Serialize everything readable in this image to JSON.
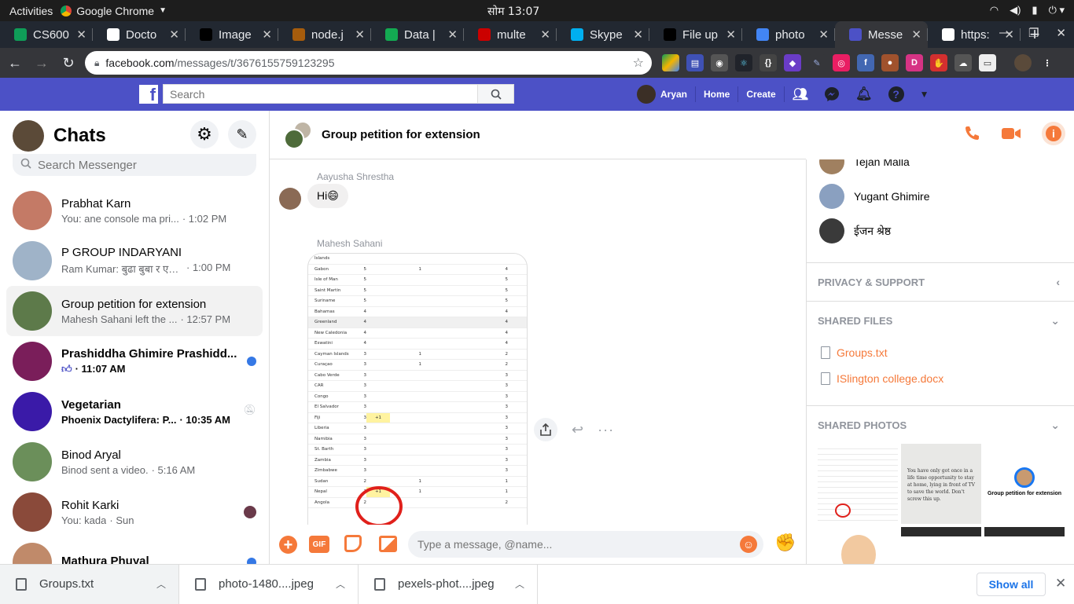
{
  "desktop": {
    "activities": "Activities",
    "app_name": "Google Chrome",
    "clock": "सोम 13:07"
  },
  "tabs": [
    {
      "title": "CS600",
      "favicon_color": "#0f9d58"
    },
    {
      "title": "Docto",
      "favicon_color": "#ffffff"
    },
    {
      "title": "Image",
      "favicon_color": "#000000"
    },
    {
      "title": "node.j",
      "favicon_color": "#a65c0c"
    },
    {
      "title": "Data |",
      "favicon_color": "#13aa52"
    },
    {
      "title": "multe",
      "favicon_color": "#cb0000"
    },
    {
      "title": "Skype",
      "favicon_color": "#00aff0"
    },
    {
      "title": "File up",
      "favicon_color": "#000000"
    },
    {
      "title": "photo",
      "favicon_color": "#4285f4"
    },
    {
      "title": "Messe",
      "favicon_color": "#4c51c6"
    },
    {
      "title": "https:",
      "favicon_color": "#ffffff"
    }
  ],
  "url": {
    "host": "facebook.com",
    "path": "/messages/t/3676155759123295"
  },
  "fb": {
    "search_placeholder": "Search",
    "user_name": "Aryan",
    "nav_home": "Home",
    "nav_create": "Create",
    "brand_color": "#4c51c6"
  },
  "sidebar": {
    "title": "Chats",
    "search_placeholder": "Search Messenger",
    "chats": [
      {
        "name": "Prabhat Karn",
        "preview": "You: ane console ma pri...",
        "time": "1:02 PM",
        "unread": false
      },
      {
        "name": "P GROUP INDARYANI",
        "preview": "Ram Kumar: बुढा बुबा र एक ...",
        "time": "1:00 PM",
        "unread": false
      },
      {
        "name": "Group petition for extension",
        "preview": "Mahesh Sahani left the ...",
        "time": "12:57 PM",
        "unread": false
      },
      {
        "name": "Prashiddha Ghimire Prashidd...",
        "preview": "",
        "time": "11:07 AM",
        "unread": true
      },
      {
        "name": "Vegetarian",
        "preview": "Phoenix Dactylifera: P...",
        "time": "10:35 AM",
        "unread": true
      },
      {
        "name": "Binod Aryal",
        "preview": "Binod sent a video.",
        "time": "5:16 AM",
        "unread": false
      },
      {
        "name": "Rohit Karki",
        "preview": "You: kada",
        "time": "Sun",
        "unread": false
      },
      {
        "name": "Mathura Phuyal",
        "preview": "",
        "time": "",
        "unread": true
      }
    ]
  },
  "conversation": {
    "title": "Group petition for extension",
    "messages": [
      {
        "sender": "Aayusha Shrestha",
        "text": "Hi😄"
      },
      {
        "sender": "Mahesh Sahani",
        "text": ""
      }
    ],
    "composer_placeholder": "Type a message, @name...",
    "accent": "#f5793a"
  },
  "sheet_rows": [
    [
      "Islands",
      "",
      "",
      "",
      ""
    ],
    [
      "Gabon",
      "5",
      "",
      "1",
      "4"
    ],
    [
      "Isle of Man",
      "5",
      "",
      "",
      "5"
    ],
    [
      "Saint Martin",
      "5",
      "",
      "",
      "5"
    ],
    [
      "Suriname",
      "5",
      "",
      "",
      "5"
    ],
    [
      "Bahamas",
      "4",
      "",
      "",
      "4"
    ],
    [
      "Greenland",
      "4",
      "",
      "",
      "4"
    ],
    [
      "New Caledonia",
      "4",
      "",
      "",
      "4"
    ],
    [
      "Eswatini",
      "4",
      "",
      "",
      "4"
    ],
    [
      "Cayman Islands",
      "3",
      "",
      "1",
      "2"
    ],
    [
      "Curaçao",
      "3",
      "",
      "1",
      "2"
    ],
    [
      "Cabo Verde",
      "3",
      "",
      "",
      "3"
    ],
    [
      "CAR",
      "3",
      "",
      "",
      "3"
    ],
    [
      "Congo",
      "3",
      "",
      "",
      "3"
    ],
    [
      "El Salvador",
      "3",
      "",
      "",
      "3"
    ],
    [
      "Fiji",
      "3",
      "+1",
      "",
      "3"
    ],
    [
      "Liberia",
      "3",
      "",
      "",
      "3"
    ],
    [
      "Namibia",
      "3",
      "",
      "",
      "3"
    ],
    [
      "St. Barth",
      "3",
      "",
      "",
      "3"
    ],
    [
      "Zambia",
      "3",
      "",
      "",
      "3"
    ],
    [
      "Zimbabwe",
      "3",
      "",
      "",
      "3"
    ],
    [
      "Sudan",
      "2",
      "",
      "1",
      "1"
    ],
    [
      "Nepal",
      "2",
      "+1",
      "1",
      "1"
    ],
    [
      "Angola",
      "2",
      "",
      "",
      "2"
    ]
  ],
  "details": {
    "members": [
      "Tejan Malla",
      "Yugant Ghimire",
      "ईजन श्रेष्ठ"
    ],
    "privacy_label": "PRIVACY & SUPPORT",
    "shared_files_label": "SHARED FILES",
    "files": [
      "Groups.txt",
      "ISlington college.docx"
    ],
    "shared_photos_label": "SHARED PHOTOS",
    "photo_quote": "You have only got once in a life time opportunity to stay at home, lying in front of TV to save the world. Don't screw this up.",
    "photo_caption": "Group petition for extension"
  },
  "downloads": {
    "items": [
      "Groups.txt",
      "photo-1480....jpeg",
      "pexels-phot....jpeg"
    ],
    "show_all": "Show all"
  }
}
